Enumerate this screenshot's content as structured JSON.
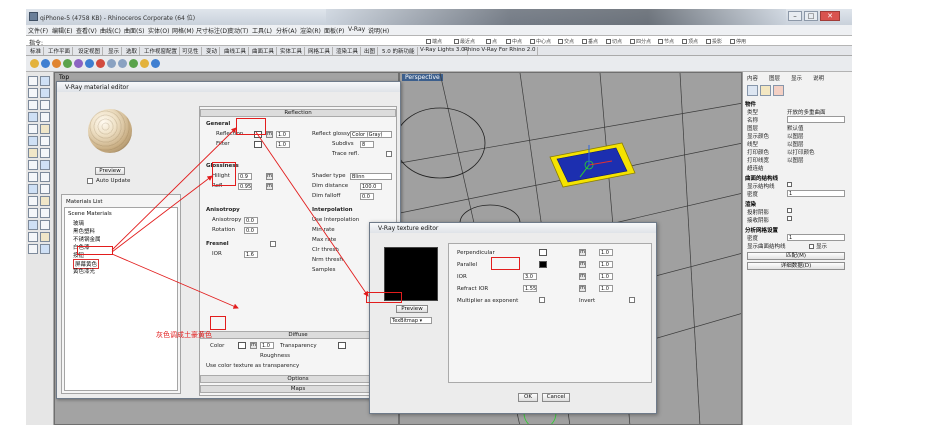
{
  "app": {
    "title": "qiPhone-5 (4758 KB) - Rhinoceros Corporate (64 位)",
    "menus": [
      "文件(F)",
      "编辑(E)",
      "查看(V)",
      "曲线(C)",
      "曲面(S)",
      "实体(O)",
      "网格(M)",
      "尺寸标注(D)",
      "变动(T)",
      "工具(L)",
      "分析(A)",
      "渲染(R)",
      "面板(P)",
      "V-Ray",
      "说明(H)"
    ],
    "command_prompt": "指令: ",
    "osnaps": [
      "端点",
      "最近点",
      "点",
      "中点",
      "中心点",
      "交点",
      "垂点",
      "切点",
      "四分点",
      "节点",
      "顶点",
      "投影",
      "停用"
    ],
    "tabs": [
      "标准",
      "工作平面",
      "设定视图",
      "显示",
      "选取",
      "工作视窗配置",
      "可见性",
      "变动",
      "曲线工具",
      "曲面工具",
      "实体工具",
      "网格工具",
      "渲染工具",
      "出图",
      "5.0 的新功能",
      "V-Ray Lights 3.0",
      "Rhino V-Ray For Rhino 2.0"
    ]
  },
  "viewports": {
    "top_label": "Top",
    "perspective_label": "Perspective"
  },
  "right_panel": {
    "tabs": [
      "内容",
      "图层",
      "显示",
      "说明"
    ],
    "sections": {
      "object": "物件",
      "isocurve": "曲面的结构线",
      "render": "渲染",
      "analysis_mesh": "分析网格设置"
    },
    "rows": [
      {
        "label": "类型",
        "value": "开放的多重曲面"
      },
      {
        "label": "名称",
        "value": ""
      },
      {
        "label": "图层",
        "value": "默认值"
      },
      {
        "label": "显示颜色",
        "value": "以图层"
      },
      {
        "label": "线型",
        "value": "以图层"
      },
      {
        "label": "打印颜色",
        "value": "以打印颜色"
      },
      {
        "label": "打印线宽",
        "value": "以图层"
      },
      {
        "label": "超连结",
        "value": ""
      }
    ],
    "isocurve_rows": [
      {
        "label": "显示结构线",
        "value": ""
      },
      {
        "label": "密度",
        "value": "1"
      }
    ],
    "render_rows": [
      {
        "label": "投射阴影",
        "value": ""
      },
      {
        "label": "接收阴影",
        "value": ""
      }
    ],
    "analysis_rows": [
      {
        "label": "密度",
        "value": "1"
      },
      {
        "label": "显示曲面结构线",
        "value": "显示"
      }
    ],
    "buttons": [
      "匹配(M)",
      "详细数据(D)"
    ]
  },
  "material_editor": {
    "title": "V-Ray material editor",
    "update_button": "Preview",
    "auto_update_label": "Auto Update",
    "material_list_title": "Materials List",
    "tree": [
      {
        "label": "Scene Materials",
        "selected": false
      },
      {
        "label": "玻璃",
        "selected": false
      },
      {
        "label": "黑色塑料",
        "selected": false
      },
      {
        "label": "不锈钢金属",
        "selected": false
      },
      {
        "label": "白色漆",
        "selected": false
      },
      {
        "label": "按钮",
        "selected": false
      },
      {
        "label": "屏幕黄色",
        "selected": true
      },
      {
        "label": "黄色漆光",
        "selected": false
      }
    ],
    "reflection": {
      "header": "Reflection",
      "general": "General",
      "reflection_label": "Reflection",
      "reflection_value": "1.0",
      "reflect_glossy_label": "Reflect glossy",
      "reflect_glossy_value": "Color (Gray)",
      "filter_label": "Filter",
      "filter_value": "1.0",
      "glossiness_label": "Glossiness",
      "hilight_label": "Hilight",
      "hilight_value": "0.9",
      "refl_label": "Refl",
      "refl_value": "0.95",
      "subdivs_label": "Subdivs",
      "subdivs_value": "8",
      "trace_label": "Trace refl.",
      "fresnel_label": "Fresnel",
      "shader_type_label": "Shader type",
      "shader_type_value": "Blinn",
      "dim_dist_label": "Dim distance",
      "dim_dist_value": "100.0",
      "anisotropy": "Anisotropy",
      "anisotropy_value": "0.0",
      "rotation_label": "Rotation",
      "rotation_value": "0.0",
      "interpolation": "Interpolation",
      "use_interp_label": "Use Interpolation",
      "min_rate_label": "Min rate",
      "max_rate_label": "Max rate",
      "clr_thresh_label": "Clr thresh",
      "nrm_thresh_label": "Nrm thresh",
      "samples_label": "Samples",
      "dim_falloff_label": "Dim falloff",
      "dim_falloff_value": "0.0",
      "ior_label": "IOR",
      "ior_value": "1.6"
    },
    "diffuse": {
      "header": "Diffuse",
      "color_label": "Color",
      "color_value": "1.0",
      "transparency_label": "Transparency",
      "roughness_label": "Roughness",
      "use_color_label": "Use color texture as transparency"
    },
    "options_header": "Options",
    "maps_header": "Maps",
    "annotation": "灰色调成土豪黄色"
  },
  "texture_editor": {
    "title": "V-Ray texture editor",
    "preview_button": "Preview",
    "type_dropdown": "TexBitmap",
    "params": [
      {
        "label": "Perpendicular",
        "value": "1.0"
      },
      {
        "label": "Parallel",
        "value": "1.0"
      },
      {
        "label": "IOR",
        "value": "3.0"
      },
      {
        "label": "Refract IOR",
        "value": "1.55"
      },
      {
        "label": "Multiplier as exponent",
        "value": ""
      }
    ],
    "invert_label": "Invert",
    "ok_label": "OK",
    "cancel_label": "Cancel"
  },
  "colors": {
    "accent_red": "#e21d1d",
    "phone_yellow": "#f5e300",
    "phone_screen": "#1c2fb0",
    "viewport_gray": "#a0a0a0"
  }
}
